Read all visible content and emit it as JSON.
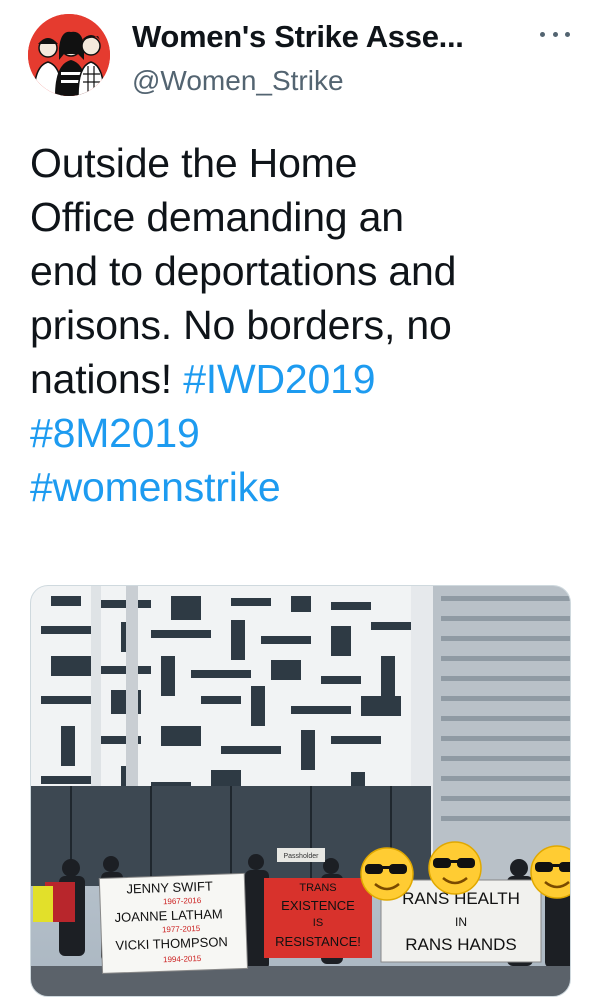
{
  "author": {
    "display_name": "Women's Strike Asse...",
    "handle": "@Women_Strike",
    "avatar_icon": "avatar-illustration"
  },
  "more_icon": "more-dots-icon",
  "tweet": {
    "text_lines": [
      "Outside the Home",
      "Office demanding an",
      "end to deportations and",
      "prisons. No borders, no"
    ],
    "text_last": "nations! ",
    "hashtags": [
      "#IWD2019",
      "#8M2019",
      "#womenstrike"
    ]
  },
  "media": {
    "banner_left": {
      "line1": "JENNY SWIFT",
      "line1_dates": "1967-2016",
      "line2": "JOANNE LATHAM",
      "line2_dates": "1977-2015",
      "line3": "VICKI THOMPSON",
      "line3_dates": "1994-2015"
    },
    "banner_middle": [
      "TRANS",
      "EXISTENCE",
      "IS",
      "RESISTANCE!"
    ],
    "banner_right": [
      "RANS HEALTH",
      "IN",
      "RANS HANDS"
    ],
    "sign_text": "Passholder"
  },
  "colors": {
    "accent": "#1d9bf0",
    "secondary_text": "#536471",
    "red_banner": "#d8322c"
  }
}
